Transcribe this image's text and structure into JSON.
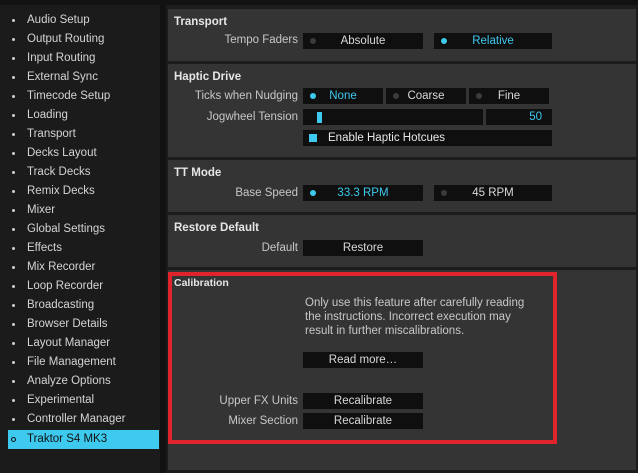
{
  "sidebar": {
    "items": [
      {
        "label": "Audio Setup"
      },
      {
        "label": "Output Routing"
      },
      {
        "label": "Input Routing"
      },
      {
        "label": "External Sync"
      },
      {
        "label": "Timecode Setup"
      },
      {
        "label": "Loading"
      },
      {
        "label": "Transport"
      },
      {
        "label": "Decks Layout"
      },
      {
        "label": "Track Decks"
      },
      {
        "label": "Remix Decks"
      },
      {
        "label": "Mixer"
      },
      {
        "label": "Global Settings"
      },
      {
        "label": "Effects"
      },
      {
        "label": "Mix Recorder"
      },
      {
        "label": "Loop Recorder"
      },
      {
        "label": "Broadcasting"
      },
      {
        "label": "Browser Details"
      },
      {
        "label": "Layout Manager"
      },
      {
        "label": "File Management"
      },
      {
        "label": "Analyze Options"
      },
      {
        "label": "Experimental"
      },
      {
        "label": "Controller Manager"
      },
      {
        "label": "Traktor S4 MK3"
      }
    ],
    "selected": "Traktor S4 MK3"
  },
  "transport": {
    "title": "Transport",
    "tempo_faders_label": "Tempo Faders",
    "absolute_label": "Absolute",
    "relative_label": "Relative",
    "selected": "Relative"
  },
  "haptic": {
    "title": "Haptic Drive",
    "ticks_label": "Ticks when Nudging",
    "none_label": "None",
    "coarse_label": "Coarse",
    "fine_label": "Fine",
    "ticks_selected": "None",
    "tension_label": "Jogwheel Tension",
    "tension_value": "50",
    "hotcues_label": "Enable Haptic Hotcues",
    "hotcues_checked": true
  },
  "tt_mode": {
    "title": "TT Mode",
    "base_speed_label": "Base Speed",
    "rpm33_label": "33.3 RPM",
    "rpm45_label": "45 RPM",
    "selected": "33.3 RPM"
  },
  "restore": {
    "title": "Restore Default",
    "default_label": "Default",
    "button_label": "Restore"
  },
  "calibration": {
    "title": "Calibration",
    "line1": "Only use this feature after carefully reading",
    "line2": "the instructions. Incorrect execution may",
    "line3": "result in further miscalibrations.",
    "read_more_label": "Read more…",
    "upper_fx_label": "Upper FX Units",
    "mixer_section_label": "Mixer Section",
    "recalibrate_label": "Recalibrate"
  },
  "colors": {
    "accent": "#3ec9ee",
    "highlight_box": "#e0242c",
    "panel": "#343434",
    "control_bg": "#0f0f0f"
  }
}
